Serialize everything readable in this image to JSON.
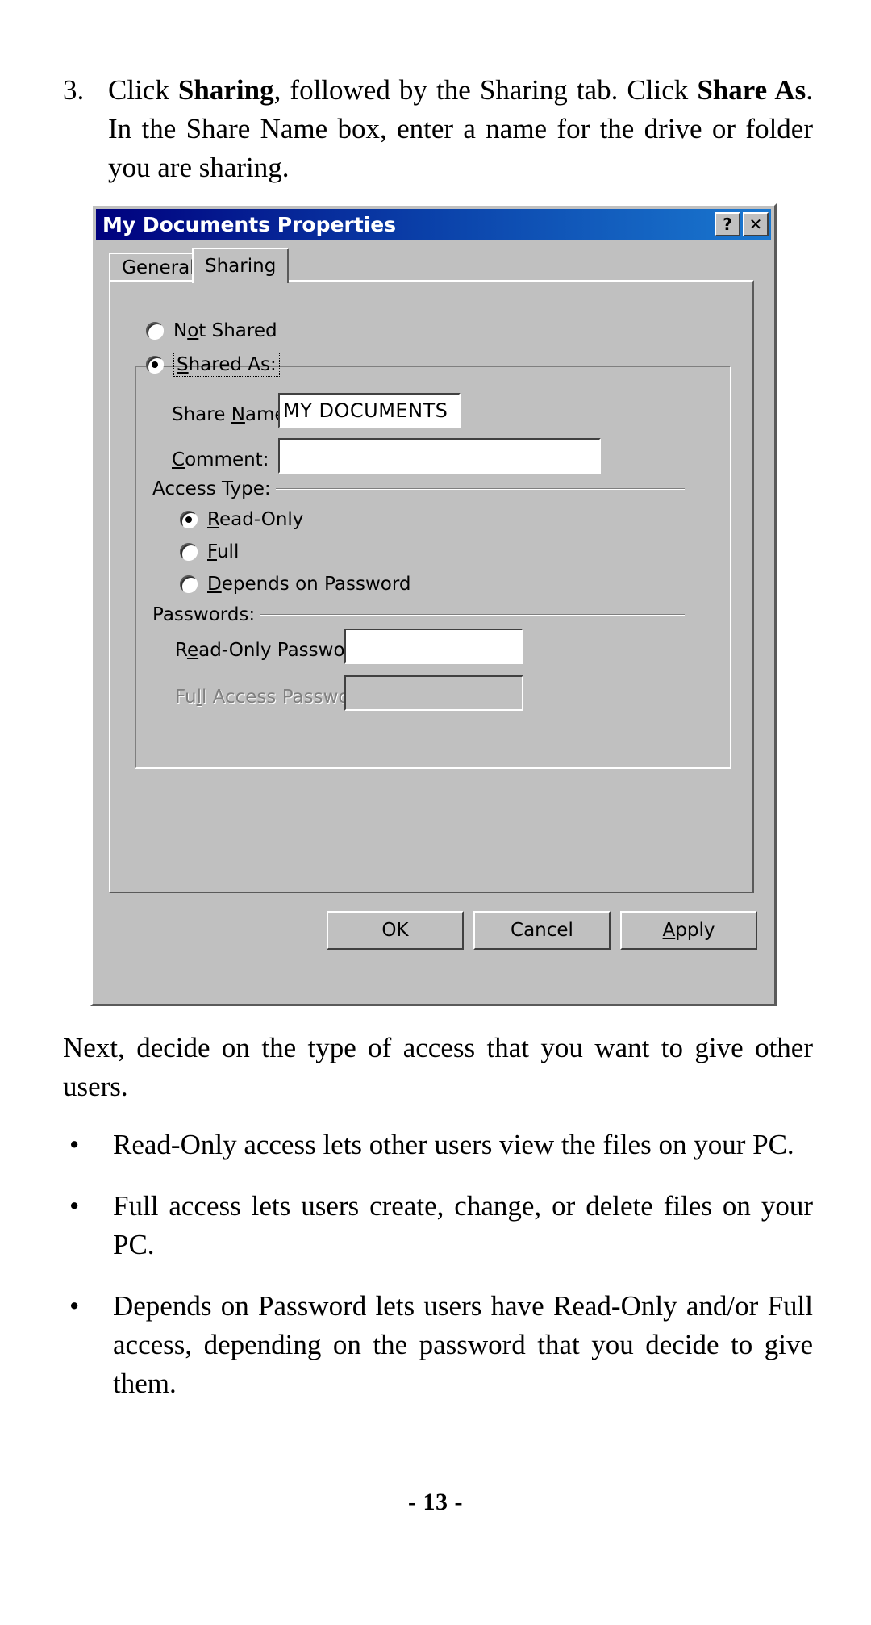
{
  "document": {
    "step": {
      "number": "3.",
      "text_parts": [
        {
          "t": "Click ",
          "bold": false
        },
        {
          "t": "Sharing",
          "bold": true
        },
        {
          "t": ", followed by the Sharing tab. Click ",
          "bold": false
        },
        {
          "t": "Share As",
          "bold": true
        },
        {
          "t": ". In the Share Name box, enter a name for the drive or folder you are sharing.",
          "bold": false
        }
      ]
    },
    "next_paragraph": "Next, decide on the type of access that you want to give other users.",
    "bullet_marker": "•",
    "bullets": [
      "Read-Only access lets other users view the files on your PC.",
      "Full access lets users create, change, or delete files on your PC.",
      "Depends on Password lets users have Read-Only and/or Full access, depending on the password that you decide to give them."
    ],
    "page_number": "- 13 -"
  },
  "dialog": {
    "title": "My Documents Properties",
    "titlebar_buttons": [
      {
        "name": "help-button",
        "glyph": "?"
      },
      {
        "name": "close-button",
        "glyph": "✕"
      }
    ],
    "tabs": [
      {
        "label": "General",
        "active": false
      },
      {
        "label": "Sharing",
        "active": true
      }
    ],
    "share_mode": {
      "not_shared_label_pre": "N",
      "not_shared_label_accel": "o",
      "not_shared_label_post": "t Shared",
      "not_shared_checked": false,
      "shared_as_label_accel": "S",
      "shared_as_label_post": "hared As:",
      "shared_as_checked": true
    },
    "fields": {
      "share_name_label_pre": "Share ",
      "share_name_label_accel": "N",
      "share_name_label_post": "ame:",
      "share_name_value": "MY DOCUMENTS",
      "comment_label_accel": "C",
      "comment_label_post": "omment:",
      "comment_value": ""
    },
    "access_type": {
      "group_label": "Access Type:",
      "options": [
        {
          "pre": "",
          "accel": "R",
          "post": "ead-Only",
          "checked": true
        },
        {
          "pre": "",
          "accel": "F",
          "post": "ull",
          "checked": false
        },
        {
          "pre": "",
          "accel": "D",
          "post": "epends on Password",
          "checked": false
        }
      ]
    },
    "passwords": {
      "group_label": "Passwords:",
      "read_only_label_pre": "R",
      "read_only_label_accel": "e",
      "read_only_label_post": "ad-Only Password:",
      "read_only_value": "",
      "read_only_disabled": false,
      "full_access_label_pre": "Fu",
      "full_access_label_accel": "l",
      "full_access_label_post": "l Access Password:",
      "full_access_value": "",
      "full_access_disabled": true
    },
    "buttons": [
      {
        "label": "OK",
        "name": "ok-button"
      },
      {
        "label": "Cancel",
        "name": "cancel-button"
      },
      {
        "label": "Apply",
        "name": "apply-button",
        "accel": "A"
      }
    ]
  },
  "colors": {
    "titlebar_start": "#00007e",
    "titlebar_end": "#1a78d0",
    "dialog_face": "#c0c0c0",
    "disabled_text": "#808080",
    "field_bg": "#ffffff"
  }
}
